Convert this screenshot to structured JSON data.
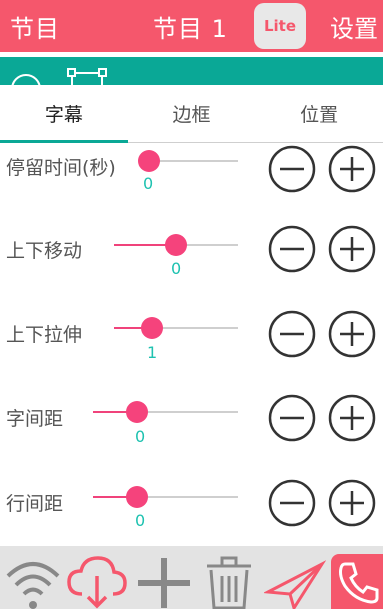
{
  "header": {
    "left_title": "节目",
    "center_title": "节目 1",
    "lite_badge": "Lite",
    "settings": "设置"
  },
  "tabs": [
    {
      "label": "字幕",
      "active": true
    },
    {
      "label": "边框",
      "active": false
    },
    {
      "label": "位置",
      "active": false
    }
  ],
  "rows": [
    {
      "label": "停留时间(秒)",
      "value": "0",
      "fraction": 0.0
    },
    {
      "label": "上下移动",
      "value": "0",
      "fraction": 0.5
    },
    {
      "label": "上下拉伸",
      "value": "1",
      "fraction": 0.31
    },
    {
      "label": "字间距",
      "value": "0",
      "fraction": 0.3
    },
    {
      "label": "行间距",
      "value": "0",
      "fraction": 0.3
    }
  ],
  "colors": {
    "header": "#f5576c",
    "accent_teal": "#0aa896",
    "slider_pink": "#f5437c",
    "value_teal": "#1ec2b0"
  },
  "bottom_icons": [
    "wifi-icon",
    "cloud-download-icon",
    "plus-icon",
    "trash-icon",
    "send-icon",
    "phone-icon"
  ]
}
